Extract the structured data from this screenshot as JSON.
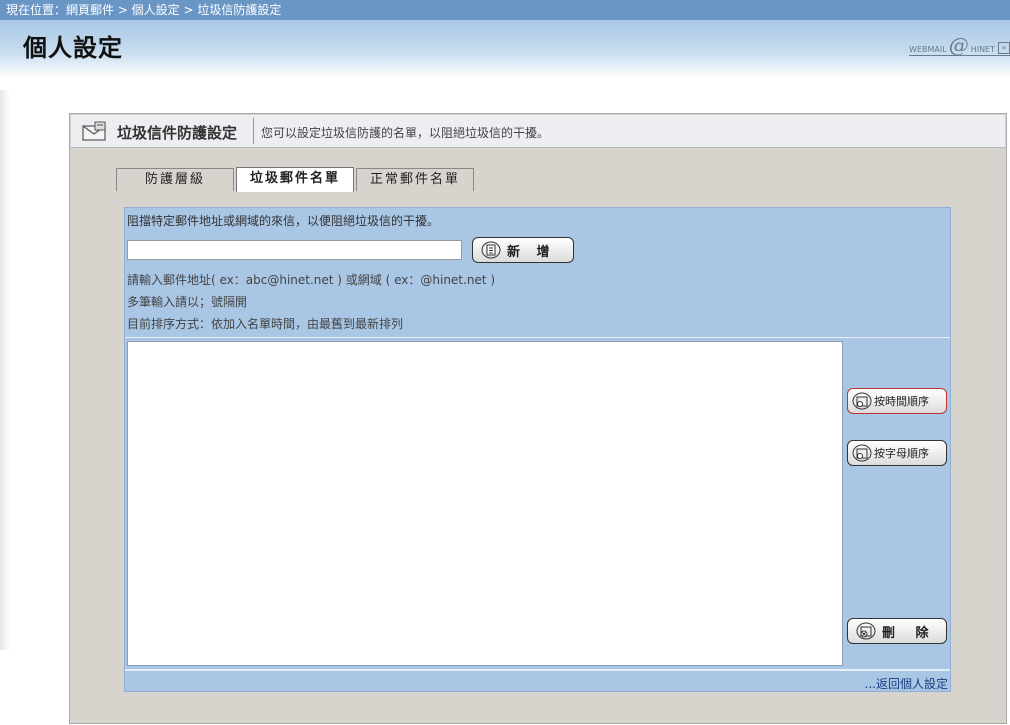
{
  "location": {
    "text": "現在位置：網頁郵件 > 個人設定 > 垃圾信防護設定"
  },
  "header": {
    "title": "個人設定",
    "brand_left": "WEBMAIL",
    "brand_at": "@",
    "brand_right": "HINET"
  },
  "panel": {
    "title": "垃圾信件防護設定",
    "hint": "您可以設定垃圾信防護的名單，以阻絕垃圾信的干擾。"
  },
  "tabs": [
    {
      "label": "防護層級"
    },
    {
      "label": "垃圾郵件名單"
    },
    {
      "label": "正常郵件名單"
    }
  ],
  "form": {
    "description": "阻擋特定郵件地址或網域的來信，以便阻絕垃圾信的干擾。",
    "input_value": "",
    "add_label": "新 增",
    "help_format": "請輸入郵件地址( ex：abc@hinet.net ) 或網域 ( ex：@hinet.net )",
    "help_multi": "多筆輸入請以；號隔開",
    "sort_status": "目前排序方式：依加入名單時間，由最舊到最新排列"
  },
  "list": {
    "items": []
  },
  "actions": {
    "sort_time": "按時間順序",
    "sort_alpha": "按字母順序",
    "delete": "刪 除"
  },
  "footer": {
    "back_link": "...返回個人設定"
  },
  "colors": {
    "topbar": "#6a96c6",
    "content_bg": "#a9c6e4",
    "panel_bg": "#d7d4ce",
    "link": "#1a3e80"
  }
}
